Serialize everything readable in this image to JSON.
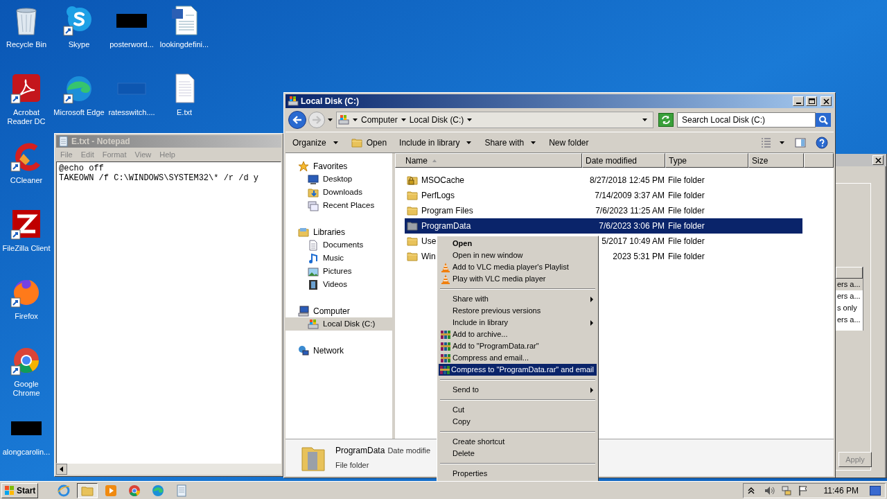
{
  "desktop_columns": [
    {
      "icons": [
        {
          "label": "Recycle Bin",
          "kind": "recycle",
          "shortcut": false
        },
        {
          "label": "Acrobat Reader DC",
          "kind": "acrobat",
          "shortcut": true
        },
        {
          "label": "CCleaner",
          "kind": "ccleaner",
          "shortcut": true
        },
        {
          "label": "FileZilla Client",
          "kind": "filezilla",
          "shortcut": true
        },
        {
          "label": "Firefox",
          "kind": "firefox",
          "shortcut": true
        },
        {
          "label": "Google Chrome",
          "kind": "chrome",
          "shortcut": true
        },
        {
          "label": "alongcarolin...",
          "kind": "redacted",
          "shortcut": false
        }
      ]
    },
    {
      "icons": [
        {
          "label": "Skype",
          "kind": "skype",
          "shortcut": true
        },
        {
          "label": "Microsoft Edge",
          "kind": "edge",
          "shortcut": true
        }
      ]
    },
    {
      "icons": [
        {
          "label": "posterword...",
          "kind": "redacted",
          "shortcut": false
        },
        {
          "label": "ratesswitch....",
          "kind": "bluefile",
          "shortcut": false
        }
      ]
    },
    {
      "icons": [
        {
          "label": "lookingdefini...",
          "kind": "word",
          "shortcut": false
        },
        {
          "label": "E.txt",
          "kind": "text",
          "shortcut": false
        }
      ]
    }
  ],
  "notepad": {
    "title": "E.txt - Notepad",
    "active": false,
    "menu": [
      "File",
      "Edit",
      "Format",
      "View",
      "Help"
    ],
    "lines": [
      "@echo off",
      "TAKEOWN /f C:\\WINDOWS\\SYSTEM32\\* /r /d y"
    ]
  },
  "dialog": {
    "active": false,
    "list_rows": [
      {
        "text": "ers a...",
        "selected": true
      },
      {
        "text": "ers a...",
        "selected": false
      },
      {
        "text": "s only",
        "selected": false
      },
      {
        "text": "ers a...",
        "selected": false
      }
    ],
    "apply_button": {
      "label": "Apply",
      "disabled": true
    }
  },
  "explorer": {
    "title": "Local Disk (C:)",
    "active": true,
    "address": [
      "Computer",
      "Local Disk (C:)"
    ],
    "search": {
      "placeholder": "Search Local Disk (C:)"
    },
    "toolbar": [
      {
        "label": "Organize",
        "kind": "dropdown"
      },
      {
        "label": "Open",
        "kind": "icon"
      },
      {
        "label": "Include in library",
        "kind": "dropdown"
      },
      {
        "label": "Share with",
        "kind": "dropdown"
      },
      {
        "label": "New folder",
        "kind": "plain"
      }
    ],
    "nav": [
      {
        "label": "Favorites",
        "kind": "star",
        "selected": false,
        "children": [
          {
            "label": "Desktop",
            "kind": "desktop",
            "selected": false
          },
          {
            "label": "Downloads",
            "kind": "downloads",
            "selected": false
          },
          {
            "label": "Recent Places",
            "kind": "recent",
            "selected": false
          }
        ]
      },
      {
        "label": "Libraries",
        "kind": "libraries",
        "selected": false,
        "children": [
          {
            "label": "Documents",
            "kind": "documents",
            "selected": false
          },
          {
            "label": "Music",
            "kind": "music",
            "selected": false
          },
          {
            "label": "Pictures",
            "kind": "pictures",
            "selected": false
          },
          {
            "label": "Videos",
            "kind": "videos",
            "selected": false
          }
        ]
      },
      {
        "label": "Computer",
        "kind": "computer",
        "selected": false,
        "children": [
          {
            "label": "Local Disk (C:)",
            "kind": "disk",
            "selected": true
          }
        ]
      },
      {
        "label": "Network",
        "kind": "network",
        "selected": false
      }
    ],
    "columns": [
      {
        "label": "Name",
        "sorted": true
      },
      {
        "label": "Date modified",
        "sorted": false
      },
      {
        "label": "Type",
        "sorted": false
      },
      {
        "label": "Size",
        "sorted": false
      }
    ],
    "rows": [
      {
        "name": "MSOCache",
        "date": "8/27/2018 12:45 PM",
        "type": "File folder",
        "kind": "locked",
        "selected": false
      },
      {
        "name": "PerfLogs",
        "date": "7/14/2009 3:37 AM",
        "type": "File folder",
        "kind": "folder",
        "selected": false
      },
      {
        "name": "Program Files",
        "date": "7/6/2023 11:25 AM",
        "type": "File folder",
        "kind": "folder",
        "selected": false
      },
      {
        "name": "ProgramData",
        "date": "7/6/2023 3:06 PM",
        "type": "File folder",
        "kind": "system",
        "selected": true
      },
      {
        "name": "Use",
        "date": "5/2017 10:49 AM",
        "type": "File folder",
        "kind": "folder",
        "selected": false
      },
      {
        "name": "Win",
        "date": "2023 5:31 PM",
        "type": "File folder",
        "kind": "folder",
        "selected": false
      }
    ],
    "details": {
      "name": "ProgramData",
      "field": "Date modifie",
      "type": "File folder"
    }
  },
  "context_menu": [
    {
      "kind": "plain",
      "label": "Open",
      "default": true,
      "submenu": false,
      "selected": false
    },
    {
      "kind": "plain",
      "label": "Open in new window",
      "default": false,
      "submenu": false,
      "selected": false
    },
    {
      "kind": "vlc",
      "label": "Add to VLC media player's Playlist",
      "default": false,
      "submenu": false,
      "selected": false
    },
    {
      "kind": "vlc",
      "label": "Play with VLC media player",
      "default": false,
      "submenu": false,
      "selected": false
    },
    {
      "kind": "separator"
    },
    {
      "kind": "plain",
      "label": "Share with",
      "default": false,
      "submenu": true,
      "selected": false
    },
    {
      "kind": "plain",
      "label": "Restore previous versions",
      "default": false,
      "submenu": false,
      "selected": false
    },
    {
      "kind": "plain",
      "label": "Include in library",
      "default": false,
      "submenu": true,
      "selected": false
    },
    {
      "kind": "rar",
      "label": "Add to archive...",
      "default": false,
      "submenu": false,
      "selected": false
    },
    {
      "kind": "rar",
      "label": "Add to \"ProgramData.rar\"",
      "default": false,
      "submenu": false,
      "selected": false
    },
    {
      "kind": "rar",
      "label": "Compress and email...",
      "default": false,
      "submenu": false,
      "selected": false
    },
    {
      "kind": "rar",
      "label": "Compress to \"ProgramData.rar\" and email",
      "default": false,
      "submenu": false,
      "selected": true
    },
    {
      "kind": "separator"
    },
    {
      "kind": "plain",
      "label": "Send to",
      "default": false,
      "submenu": true,
      "selected": false
    },
    {
      "kind": "separator"
    },
    {
      "kind": "plain",
      "label": "Cut",
      "default": false,
      "submenu": false,
      "selected": false
    },
    {
      "kind": "plain",
      "label": "Copy",
      "default": false,
      "submenu": false,
      "selected": false
    },
    {
      "kind": "separator"
    },
    {
      "kind": "plain",
      "label": "Create shortcut",
      "default": false,
      "submenu": false,
      "selected": false
    },
    {
      "kind": "plain",
      "label": "Delete",
      "default": false,
      "submenu": false,
      "selected": false
    },
    {
      "kind": "separator"
    },
    {
      "kind": "plain",
      "label": "Properties",
      "default": false,
      "submenu": false,
      "selected": false
    }
  ],
  "taskbar": {
    "start": "Start",
    "buttons": [
      {
        "kind": "ie",
        "active": false
      },
      {
        "kind": "explorer",
        "active": true
      },
      {
        "kind": "media",
        "active": false
      },
      {
        "kind": "chrome",
        "active": false
      },
      {
        "kind": "edge",
        "active": false
      },
      {
        "kind": "notepad",
        "active": false
      }
    ],
    "clock": "11:46 PM"
  }
}
